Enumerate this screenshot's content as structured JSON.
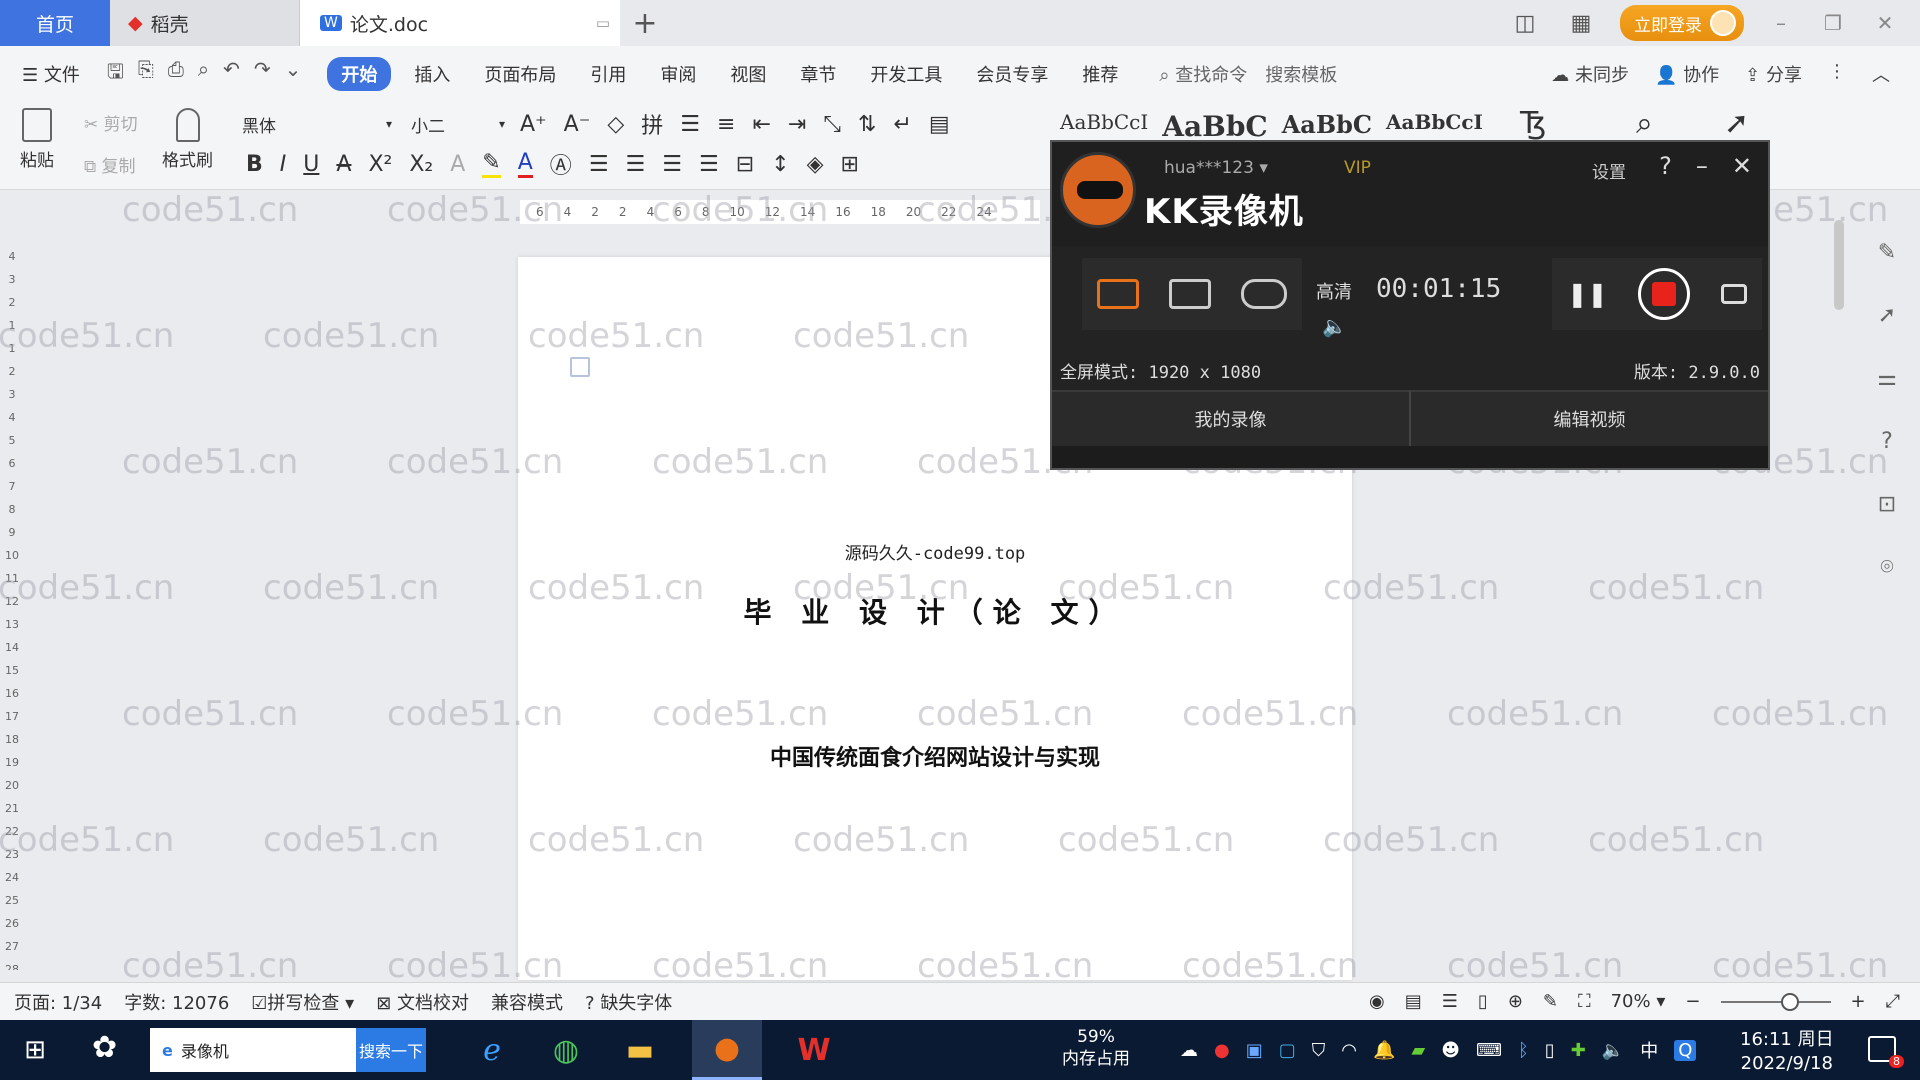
{
  "tabs": {
    "home": "首页",
    "daoke": "稻壳",
    "doc": "论文.doc"
  },
  "titlebar": {
    "login": "立即登录"
  },
  "menu": {
    "file": "文件",
    "items": [
      "开始",
      "插入",
      "页面布局",
      "引用",
      "审阅",
      "视图",
      "章节",
      "开发工具",
      "会员专享",
      "推荐"
    ],
    "search_cmd": "查找命令",
    "search_tpl": "搜索模板",
    "unsynced": "未同步",
    "collab": "协作",
    "share": "分享"
  },
  "ribbon": {
    "paste": "粘贴",
    "cut": "剪切",
    "copy": "复制",
    "format_painter": "格式刷",
    "font": "黑体",
    "size": "小二",
    "styles": [
      "AaBbCcI",
      "AaBbC",
      "AaBbC",
      "AaBbCcI"
    ]
  },
  "ruler": {
    "ticks": [
      "6",
      "4",
      "2",
      "2",
      "4",
      "6",
      "8",
      "10",
      "12",
      "14",
      "16",
      "18",
      "20",
      "22",
      "24"
    ]
  },
  "vruler": {
    "ticks": [
      "4",
      "3",
      "2",
      "1",
      "1",
      "2",
      "3",
      "4",
      "5",
      "6",
      "7",
      "8",
      "9",
      "10",
      "11",
      "12",
      "13",
      "14",
      "15",
      "16",
      "17",
      "18",
      "19",
      "20",
      "21",
      "22",
      "23",
      "24",
      "25",
      "26",
      "27",
      "28"
    ]
  },
  "document": {
    "header": "源码久久-code99.top",
    "title": "毕 业 设 计（论 文）",
    "subtitle": "中国传统面食介绍网站设计与实现"
  },
  "watermark": "code51.cn",
  "recorder": {
    "brand": "KK录像机",
    "user": "hua***123",
    "vip": "VIP",
    "settings": "设置",
    "quality": "高清",
    "timer": "00:01:15",
    "fullscreen": "全屏模式: 1920 x 1080",
    "version": "版本: 2.9.0.0",
    "my_videos": "我的录像",
    "edit_video": "编辑视频"
  },
  "status": {
    "page": "页面: 1/34",
    "words": "字数: 12076",
    "spellcheck": "拼写检查",
    "proof": "文档校对",
    "compat": "兼容模式",
    "missing_font": "缺失字体",
    "zoom": "70%"
  },
  "taskbar": {
    "search_text": "录像机",
    "search_btn": "搜索一下",
    "mem_pct": "59%",
    "mem_label": "内存占用",
    "ime": "中",
    "time": "16:11 周日",
    "date": "2022/9/18",
    "notif_count": "8"
  },
  "colors": {
    "accent": "#3f74e0",
    "record_red": "#e8231c",
    "login_orange": "#f5a623"
  }
}
